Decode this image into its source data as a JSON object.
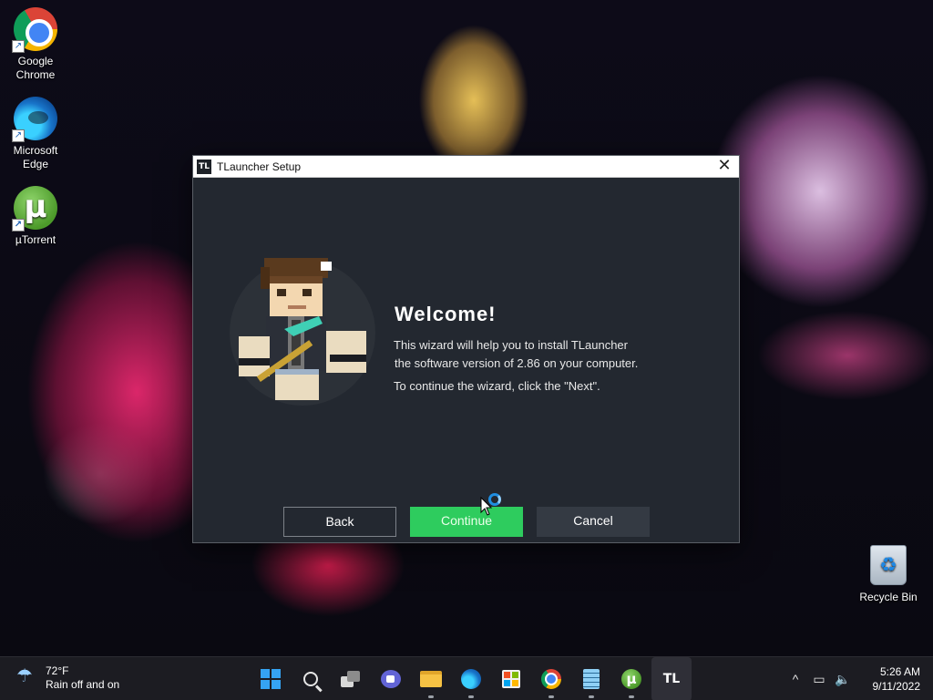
{
  "desktop": {
    "icons": [
      {
        "label_line1": "Google",
        "label_line2": "Chrome",
        "icon": "chrome-icon"
      },
      {
        "label_line1": "Microsoft",
        "label_line2": "Edge",
        "icon": "edge-icon"
      },
      {
        "label_line1": "µTorrent",
        "label_line2": "",
        "icon": "utorrent-icon"
      },
      {
        "label_line1": "Recycle Bin",
        "label_line2": "",
        "icon": "recycle-bin-icon"
      }
    ]
  },
  "window": {
    "title": "TLauncher Setup",
    "title_icon_text": "TL",
    "close_glyph": "✕",
    "heading": "Welcome!",
    "description_line1": "This wizard will help you to install TLauncher",
    "description_line2": "the software version of 2.86 on your computer.",
    "hint": "To continue the wizard, click the \"Next\".",
    "buttons": {
      "back": "Back",
      "continue": "Continue",
      "cancel": "Cancel"
    },
    "colors": {
      "background": "#232830",
      "continue_button": "#2ecc5e",
      "cancel_button": "#343a43"
    }
  },
  "taskbar": {
    "weather": {
      "temperature": "72°F",
      "condition": "Rain off and on",
      "icon": "rain-umbrella-icon"
    },
    "apps": [
      {
        "name": "start",
        "icon": "windows-start-icon"
      },
      {
        "name": "search",
        "icon": "search-icon"
      },
      {
        "name": "task-view",
        "icon": "task-view-icon"
      },
      {
        "name": "chat",
        "icon": "chat-icon"
      },
      {
        "name": "file-explorer",
        "icon": "folder-icon"
      },
      {
        "name": "edge",
        "icon": "edge-icon"
      },
      {
        "name": "store",
        "icon": "store-icon"
      },
      {
        "name": "chrome",
        "icon": "chrome-icon"
      },
      {
        "name": "notepad",
        "icon": "notepad-icon"
      },
      {
        "name": "utorrent",
        "icon": "utorrent-icon"
      },
      {
        "name": "tlauncher",
        "icon": "tlauncher-icon",
        "label": "TL"
      }
    ],
    "tray": {
      "chevron": "^",
      "time": "5:26 AM",
      "date": "9/11/2022"
    }
  }
}
